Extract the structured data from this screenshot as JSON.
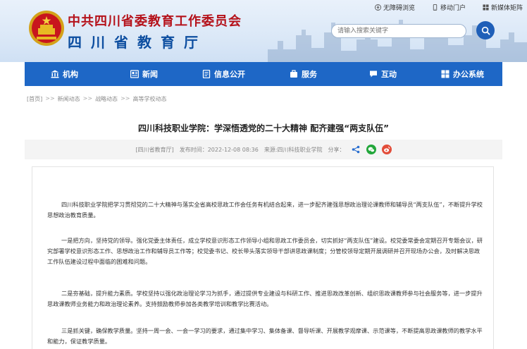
{
  "header": {
    "title_cn": "中共四川省委教育工作委员会",
    "title_edu": "四川省教育厅",
    "top_links": [
      {
        "label": "无障碍浏览",
        "icon": "accessibility-icon"
      },
      {
        "label": "移动门户",
        "icon": "mobile-icon"
      },
      {
        "label": "新媒体矩阵",
        "icon": "media-matrix-icon"
      }
    ],
    "search_placeholder": "请输入搜索关键字"
  },
  "nav": {
    "items": [
      {
        "label": "机构",
        "icon": "institution-icon"
      },
      {
        "label": "新闻",
        "icon": "news-icon"
      },
      {
        "label": "信息公开",
        "icon": "info-public-icon"
      },
      {
        "label": "服务",
        "icon": "service-icon"
      },
      {
        "label": "互动",
        "icon": "interaction-icon"
      },
      {
        "label": "办公系统",
        "icon": "office-icon"
      }
    ]
  },
  "breadcrumb": [
    "[首页]",
    "新闻动态",
    "战略动态",
    "高等学校动态"
  ],
  "article": {
    "title": "四川科技职业学院：学深悟透党的二十大精神 配齐建强“两支队伍”",
    "meta_source_tag": "[四川省教育厅]",
    "meta_date": "发布时间：2022-12-08 08:36",
    "meta_origin": "来源:四川科技职业学院",
    "share_label": "分享：",
    "paragraphs": [
      "四川科技职业学院把学习贯彻党的二十大精神与落实全省高校思政工作会任务有机结合起来，进一步配齐建强思想政治理论课教师和辅导员“两支队伍”，不断提升学校思想政治教育质量。",
      "一是把方向，坚持党的领导。强化党委主体责任，成立学校意识形态工作领导小组和思政工作委员会，切实抓好“两支队伍”建设。校党委常委会定期召开专题会议，研究部署学校意识形态工作、思想政治工作和辅导员工作等；校党委书记、校长带头落实领导干部讲思政课制度；分管校领导定期开展调研并召开现场办公会，及时解决思政工作队伍建设过程中面临的困难和问题。",
      "二是夯基础，提升能力素质。学校坚持以强化政治理论学习为抓手，通过提供专业建设与科研工作、推进思政改革创新、组织思政课教师参与社会服务等，进一步提升思政课教师业务能力和政治理论素养。支持鼓励教师参加各类教学培训和教学比赛活动。",
      "三是抓关键，确保教学质量。坚持一周一会、一会一学习的要求，通过集中学习、集体备课、督导听课、开展教学观摩课、示范课等，不断提高思政课教师的教学水平和能力，保证教学质量。"
    ]
  },
  "colors": {
    "brand_red": "#b5121b",
    "brand_blue": "#0d4ea0",
    "nav_blue": "#1e67c6"
  }
}
